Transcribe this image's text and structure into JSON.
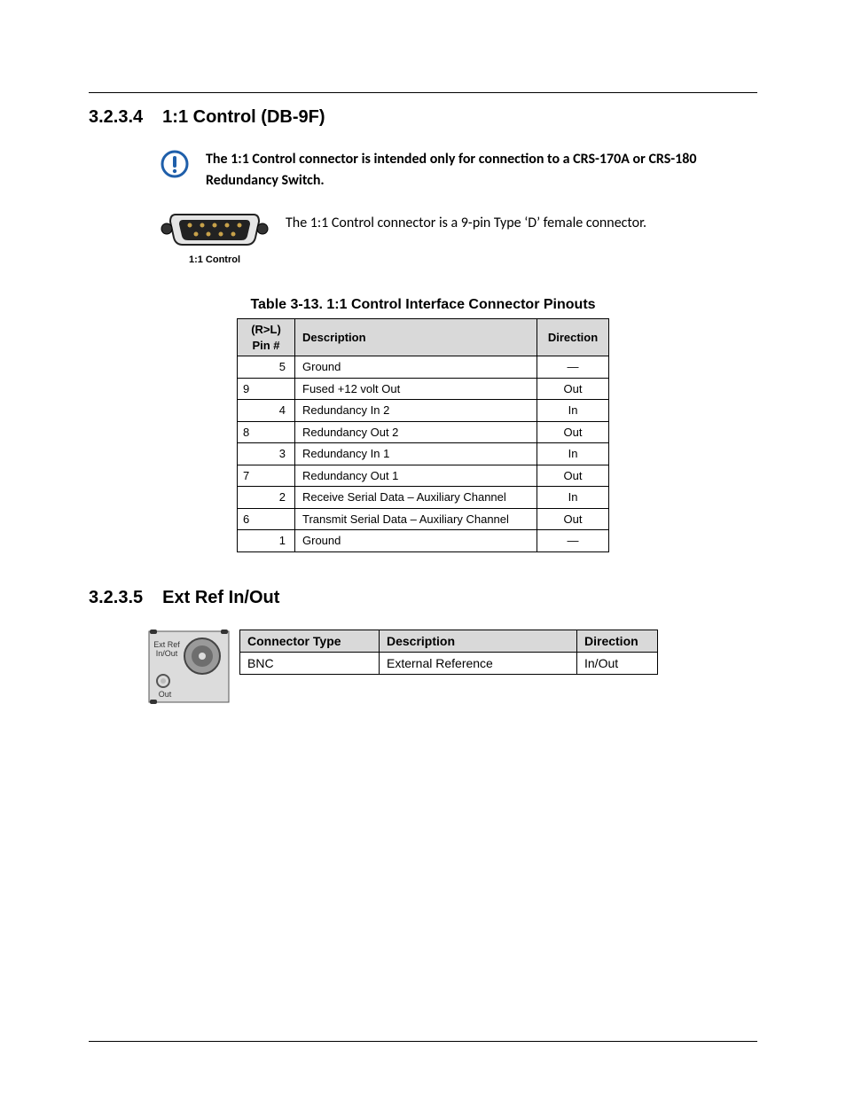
{
  "section1": {
    "number": "3.2.3.4",
    "title": "1:1 Control (DB-9F)",
    "note": "The 1:1 Control connector is intended only for connection to a CRS-170A or CRS-180 Redundancy Switch.",
    "figure_caption": "1:1 Control",
    "description": "The 1:1 Control connector is a 9-pin Type ‘D’ female connector.",
    "table_caption": "Table 3-13.  1:1 Control Interface Connector Pinouts",
    "headers": {
      "pin": "(R>L)\nPin #",
      "desc": "Description",
      "dir": "Direction"
    },
    "rows": [
      {
        "pin": "5",
        "desc": "Ground",
        "dir": "—",
        "align": "right"
      },
      {
        "pin": "9",
        "desc": "Fused +12 volt Out",
        "dir": "Out",
        "align": "left"
      },
      {
        "pin": "4",
        "desc": "Redundancy In 2",
        "dir": "In",
        "align": "right"
      },
      {
        "pin": "8",
        "desc": "Redundancy Out 2",
        "dir": "Out",
        "align": "left"
      },
      {
        "pin": "3",
        "desc": "Redundancy In 1",
        "dir": "In",
        "align": "right"
      },
      {
        "pin": "7",
        "desc": "Redundancy Out 1",
        "dir": "Out",
        "align": "left"
      },
      {
        "pin": "2",
        "desc": "Receive Serial Data – Auxiliary Channel",
        "dir": "In",
        "align": "right"
      },
      {
        "pin": "6",
        "desc": "Transmit Serial Data – Auxiliary Channel",
        "dir": "Out",
        "align": "left"
      },
      {
        "pin": "1",
        "desc": "Ground",
        "dir": "—",
        "align": "right"
      }
    ]
  },
  "section2": {
    "number": "3.2.3.5",
    "title": "Ext Ref In/Out",
    "figure": {
      "labels": [
        "Ext Ref",
        "In/Out",
        "Out"
      ]
    },
    "headers": {
      "type": "Connector Type",
      "desc": "Description",
      "dir": "Direction"
    },
    "rows": [
      {
        "type": "BNC",
        "desc": "External Reference",
        "dir": "In/Out"
      }
    ]
  },
  "colors": {
    "info_icon": "#1f5faa",
    "header_bg": "#d9d9d9"
  }
}
